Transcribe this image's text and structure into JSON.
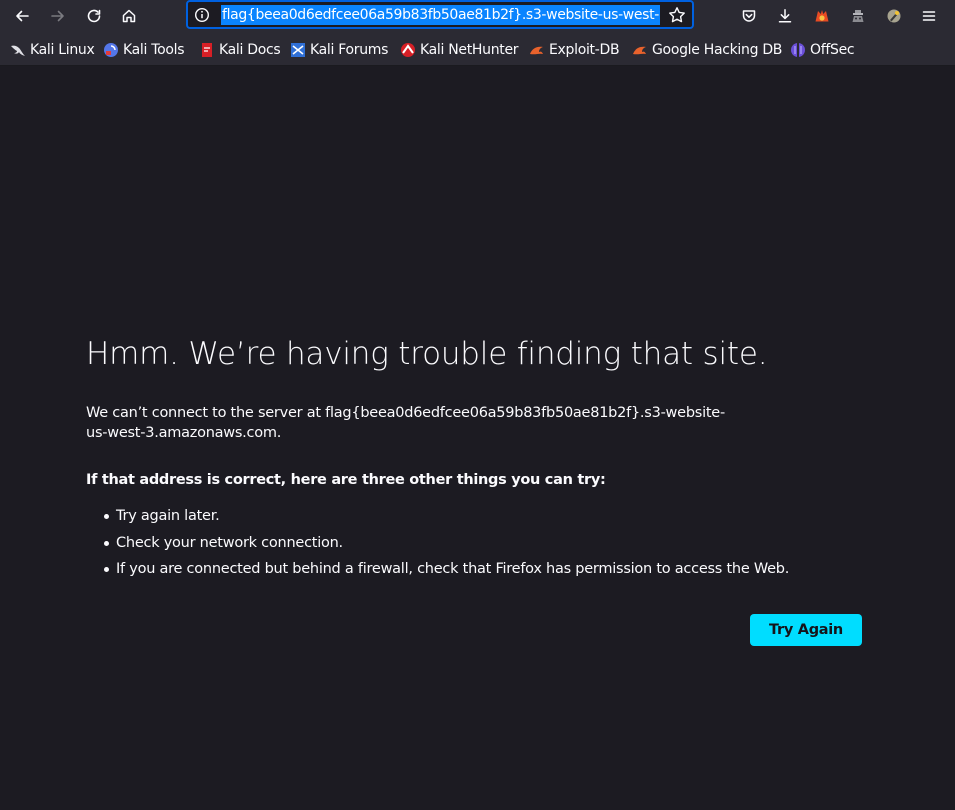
{
  "toolbar": {
    "url": "flag{beea0d6edfcee06a59b83fb50ae81b2f}.s3-website-us-west-",
    "icons": [
      "back-icon",
      "forward-icon",
      "reload-icon",
      "home-icon",
      "info-icon",
      "bookmark-star-icon",
      "pocket-icon",
      "downloads-icon",
      "extension-icon",
      "extension-icon",
      "extension-icon",
      "menu-icon"
    ],
    "accent_color": "#0061e0",
    "url_highlight_color": "#0a84ff"
  },
  "bookmarks": [
    {
      "label": "Kali Linux",
      "icon": "kali-dragon-icon"
    },
    {
      "label": "Kali Tools",
      "icon": "kali-tools-icon"
    },
    {
      "label": "Kali Docs",
      "icon": "kali-docs-icon"
    },
    {
      "label": "Kali Forums",
      "icon": "kali-forums-icon"
    },
    {
      "label": "Kali NetHunter",
      "icon": "nethunter-icon"
    },
    {
      "label": "Exploit-DB",
      "icon": "exploit-db-icon"
    },
    {
      "label": "Google Hacking DB",
      "icon": "ghdb-icon"
    },
    {
      "label": "OffSec",
      "icon": "offsec-icon"
    }
  ],
  "error": {
    "title": "Hmm. We’re having trouble finding that site.",
    "description": "We can’t connect to the server at flag{beea0d6edfcee06a59b83fb50ae81b2f}.s3-website-us-west-3.amazonaws.com.",
    "suggest_heading": "If that address is correct, here are three other things you can try:",
    "suggestions": [
      "Try again later.",
      "Check your network connection.",
      "If you are connected but behind a firewall, check that Firefox has permission to access the Web."
    ],
    "try_again_label": "Try Again",
    "button_color": "#00ddff"
  }
}
